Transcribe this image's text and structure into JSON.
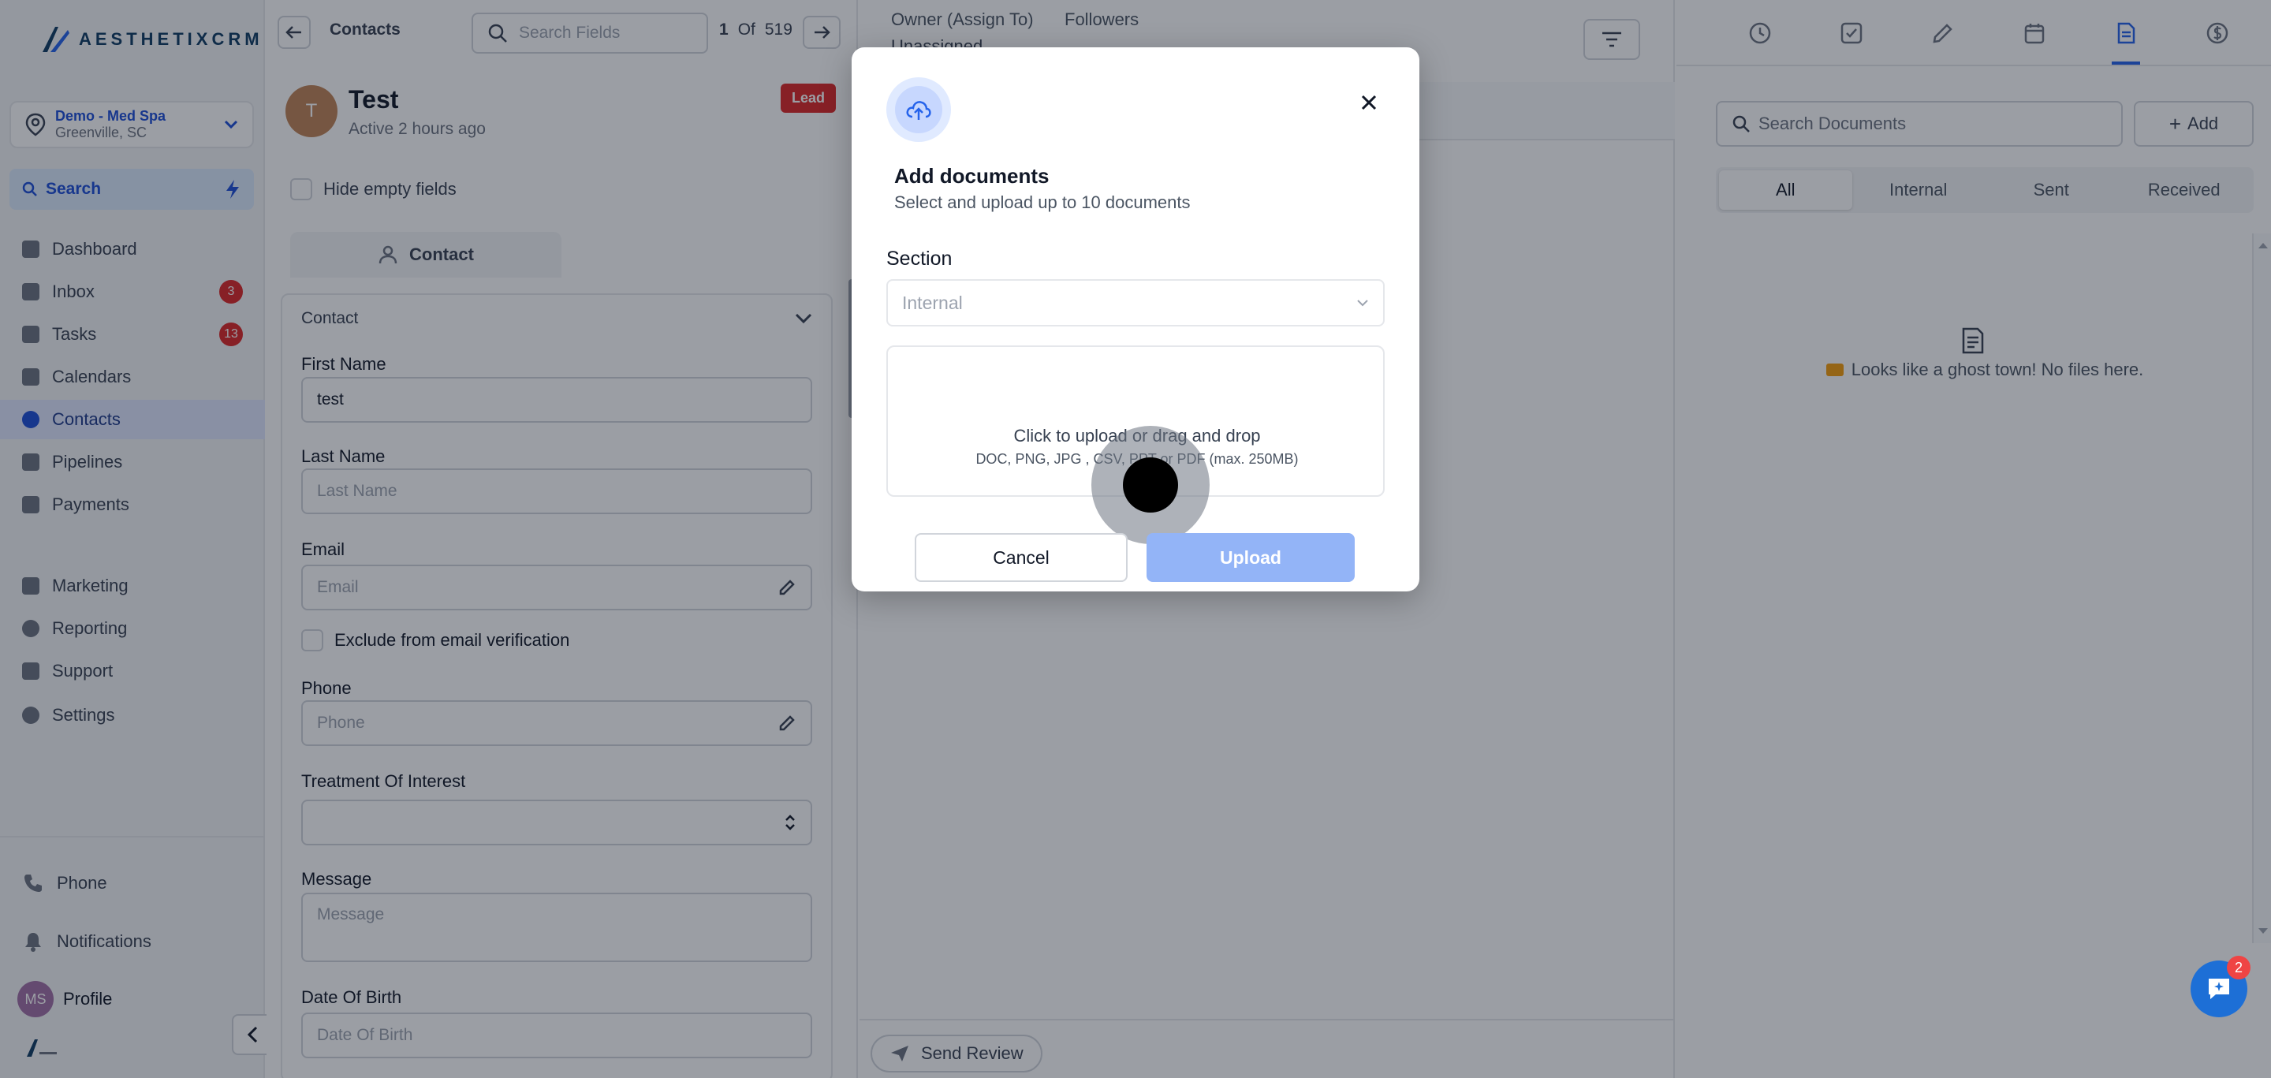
{
  "brand": {
    "logo_text": "AESTHETIXCRM",
    "accent": "#2563eb"
  },
  "location": {
    "name": "Demo - Med Spa",
    "city": "Greenville, SC"
  },
  "nav": {
    "search_label": "Search",
    "items": [
      {
        "label": "Dashboard",
        "icon": "dashboard-icon"
      },
      {
        "label": "Inbox",
        "icon": "inbox-icon",
        "badge": "3"
      },
      {
        "label": "Tasks",
        "icon": "tasks-icon",
        "badge": "13"
      },
      {
        "label": "Calendars",
        "icon": "calendar-icon"
      },
      {
        "label": "Contacts",
        "icon": "contacts-icon",
        "active": true
      },
      {
        "label": "Pipelines",
        "icon": "pipelines-icon"
      },
      {
        "label": "Payments",
        "icon": "payments-icon"
      },
      {
        "label": "Marketing",
        "icon": "marketing-icon"
      },
      {
        "label": "Reporting",
        "icon": "reporting-icon"
      },
      {
        "label": "Support",
        "icon": "support-icon"
      },
      {
        "label": "Settings",
        "icon": "settings-icon"
      }
    ],
    "bottom": {
      "phone": "Phone",
      "notifications": "Notifications",
      "profile": "Profile",
      "profile_initials": "MS"
    }
  },
  "detail": {
    "crumb": "Contacts",
    "field_search_placeholder": "Search Fields",
    "pager": {
      "current": "1",
      "of": "Of",
      "total": "519"
    },
    "contact": {
      "initial": "T",
      "name": "Test",
      "status": "Active 2 hours ago",
      "badge": "Lead"
    },
    "hide_empty_label": "Hide empty fields",
    "tab_label": "Contact",
    "section_title": "Contact",
    "fields": {
      "first_name_label": "First Name",
      "first_name_value": "test",
      "last_name_label": "Last Name",
      "last_name_placeholder": "Last Name",
      "email_label": "Email",
      "email_placeholder": "Email",
      "exclude_label": "Exclude from email verification",
      "phone_label": "Phone",
      "phone_placeholder": "Phone",
      "treatment_label": "Treatment Of Interest",
      "message_label": "Message",
      "message_placeholder": "Message",
      "dob_label": "Date Of Birth",
      "dob_placeholder": "Date Of Birth"
    }
  },
  "middle": {
    "owner_label": "Owner (Assign To)",
    "owner_value": "Unassigned",
    "followers_label": "Followers",
    "send_review": "Send Review"
  },
  "right": {
    "tab_icons": [
      "activity-icon",
      "task-check-icon",
      "pen-icon",
      "calendar-icon",
      "document-icon",
      "dollar-icon"
    ],
    "search_placeholder": "Search Documents",
    "add_label": "Add",
    "segments": [
      "All",
      "Internal",
      "Sent",
      "Received"
    ],
    "empty_message": "Looks like a ghost town! No files here.",
    "chat_badge": "2"
  },
  "modal": {
    "title": "Add documents",
    "subtitle": "Select and upload up to 10 documents",
    "section_label": "Section",
    "section_value": "Internal",
    "drop_main": "Click to upload or drag and drop",
    "drop_sub": "DOC, PNG, JPG , CSV, PPT or PDF (max. 250MB)",
    "cancel": "Cancel",
    "upload": "Upload"
  }
}
